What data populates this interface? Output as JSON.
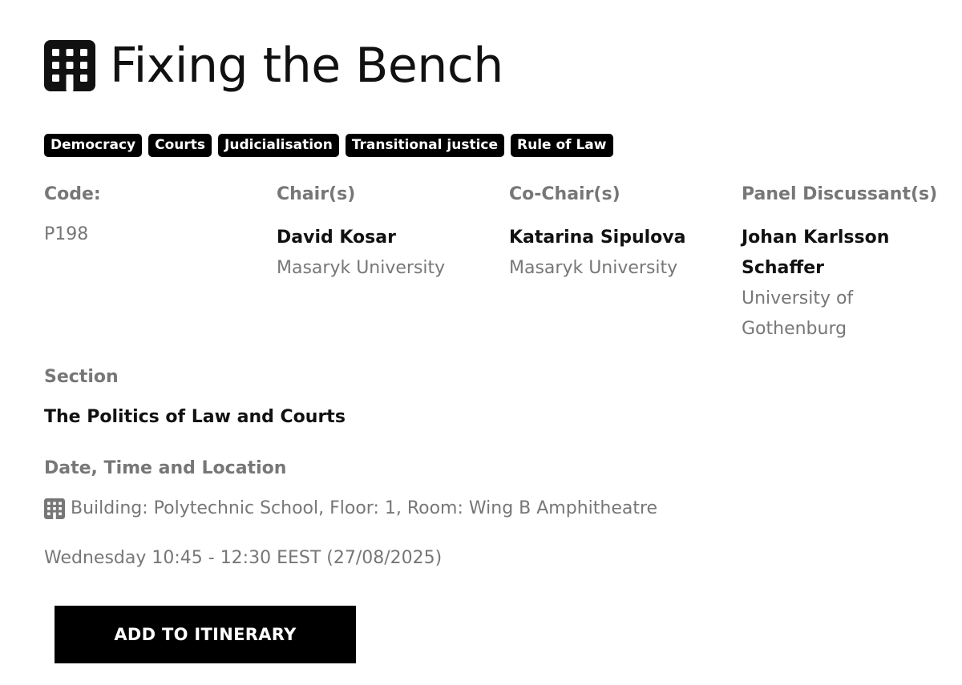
{
  "page": {
    "title": "Fixing the Bench",
    "title_icon": "building-icon"
  },
  "tags": [
    "Democracy",
    "Courts",
    "Judicialisation",
    "Transitional justice",
    "Rule of Law"
  ],
  "code": {
    "label": "Code:",
    "value": "P198"
  },
  "chair": {
    "label": "Chair(s)",
    "name": "David Kosar",
    "institution": "Masaryk University"
  },
  "co_chair": {
    "label": "Co-Chair(s)",
    "name": "Katarina Sipulova",
    "institution": "Masaryk University"
  },
  "discussant": {
    "label": "Panel Discussant(s)",
    "name": "Johan Karlsson Schaffer",
    "institution": "University of Gothenburg"
  },
  "section": {
    "label": "Section",
    "value": "The Politics of Law and Courts"
  },
  "schedule": {
    "label": "Date, Time and Location",
    "location_icon": "building-icon",
    "location": "Building: Polytechnic School, Floor: 1, Room: Wing B Amphitheatre",
    "when": "Wednesday 10:45 - 12:30 EEST (27/08/2025)"
  },
  "actions": {
    "add_itinerary_label": "ADD TO ITINERARY"
  },
  "colors": {
    "text_dark": "#111111",
    "text_muted": "#777777",
    "tag_bg": "#000000",
    "button_bg": "#000000"
  }
}
